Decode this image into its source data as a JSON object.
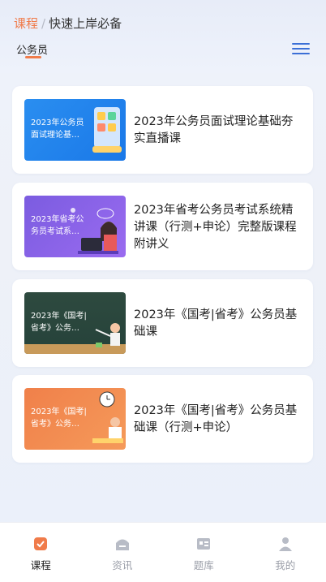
{
  "header": {
    "crumb_main": "课程",
    "crumb_sep": "/",
    "crumb_sub": "快速上岸必备",
    "active_tab": "公务员"
  },
  "courses": [
    {
      "thumb_text": "2023年公务员面试理论基…",
      "title": "2023年公务员面试理论基础夯实直播课"
    },
    {
      "thumb_text": "2023年省考公务员考试系…",
      "title": "2023年省考公务员考试系统精讲课（行测+申论）完整版课程附讲义"
    },
    {
      "thumb_text": "2023年《国考|省考》公务…",
      "title": "2023年《国考|省考》公务员基础课"
    },
    {
      "thumb_text": "2023年《国考|省考》公务…",
      "title": "2023年《国考|省考》公务员基础课（行测+申论）"
    }
  ],
  "bottom_nav": [
    {
      "label": "课程",
      "icon": "course-icon",
      "active": true
    },
    {
      "label": "资讯",
      "icon": "news-icon",
      "active": false
    },
    {
      "label": "题库",
      "icon": "question-bank-icon",
      "active": false
    },
    {
      "label": "我的",
      "icon": "profile-icon",
      "active": false
    }
  ],
  "colors": {
    "accent": "#f07b4a",
    "menu_blue": "#3b6fd6"
  }
}
